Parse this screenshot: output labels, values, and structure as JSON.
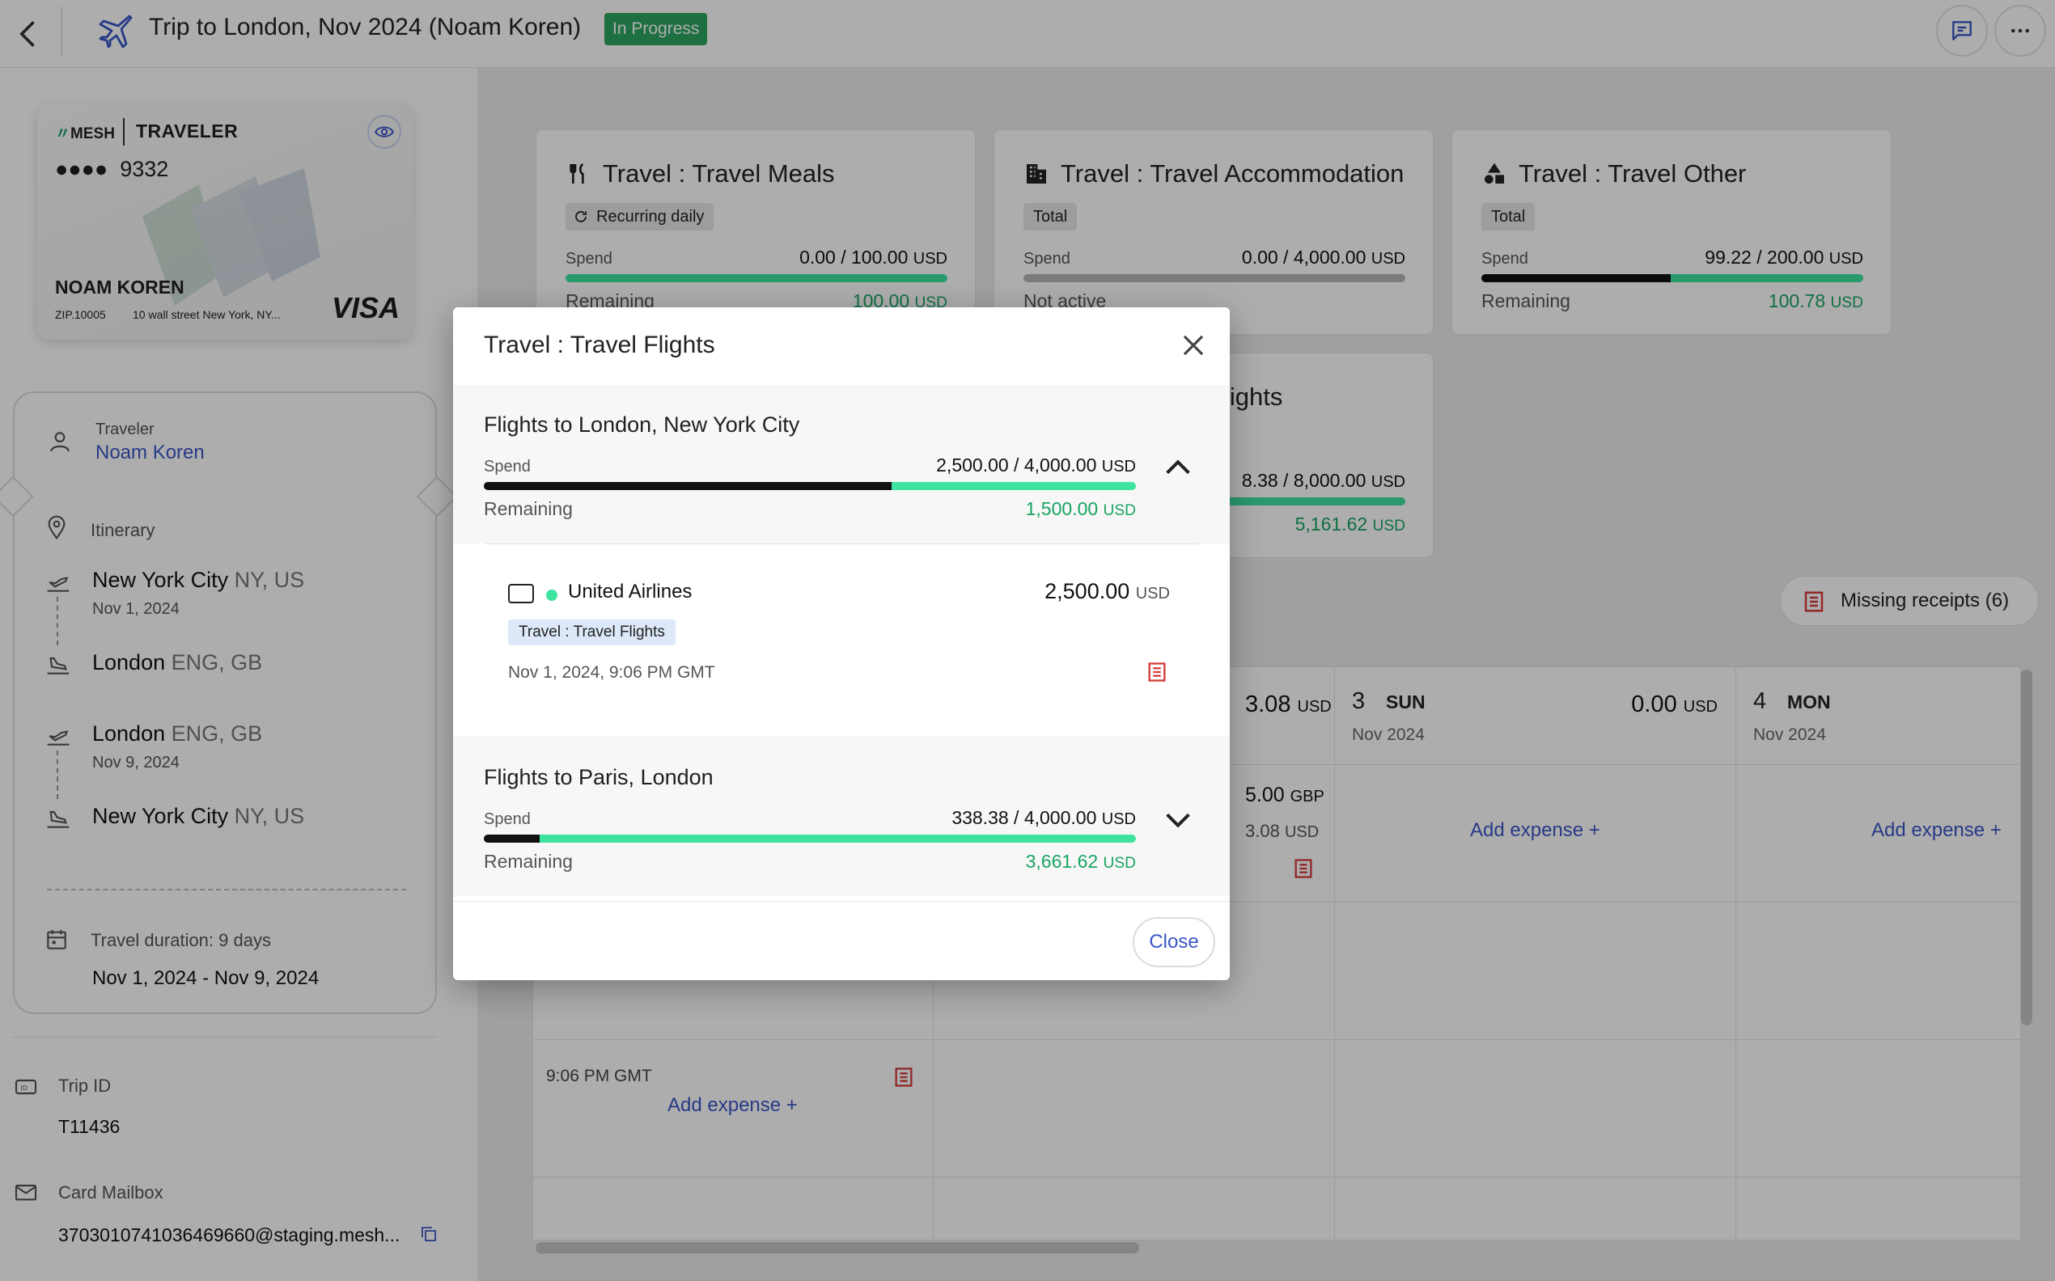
{
  "header": {
    "title": "Trip to London, Nov 2024 (Noam Koren)",
    "status": "In Progress"
  },
  "card": {
    "brand": "MESH",
    "kind": "TRAVELER",
    "dots": "●●●●",
    "last4": "9332",
    "holder": "NOAM KOREN",
    "zip": "ZIP.10005",
    "address": "10 wall street New York, NY...",
    "network": "VISA"
  },
  "ticket": {
    "traveler_label": "Traveler",
    "traveler_name": "Noam Koren",
    "itinerary_label": "Itinerary",
    "legs": [
      {
        "city": "New York City",
        "region": "NY, US",
        "date": "Nov 1, 2024"
      },
      {
        "city": "London",
        "region": "ENG, GB",
        "date": ""
      },
      {
        "city": "London",
        "region": "ENG, GB",
        "date": "Nov 9, 2024"
      },
      {
        "city": "New York City",
        "region": "NY, US",
        "date": ""
      }
    ],
    "duration_label": "Travel duration: 9 days",
    "duration_range": "Nov 1, 2024 - Nov 9, 2024"
  },
  "trip_info": {
    "trip_id_label": "Trip ID",
    "trip_id": "T11436",
    "mailbox_label": "Card Mailbox",
    "mailbox": "3703010741036469660@staging.mesh..."
  },
  "budgets": {
    "meals": {
      "title": "Travel : Travel Meals",
      "chip": "Recurring daily",
      "spend_label": "Spend",
      "spend": "0.00 / 100.00",
      "unit": "USD",
      "remaining_label": "Remaining",
      "remaining": "100.00",
      "spent_fraction": 0.0
    },
    "accommodation": {
      "title": "Travel : Travel Accommodation",
      "chip": "Total",
      "spend_label": "Spend",
      "spend": "0.00 / 4,000.00",
      "unit": "USD",
      "remaining_label": "Not active",
      "spent_fraction": 0.0
    },
    "other": {
      "title": "Travel : Travel Other",
      "chip": "Total",
      "spend_label": "Spend",
      "spend": "99.22 / 200.00",
      "unit": "USD",
      "remaining_label": "Remaining",
      "remaining": "100.78",
      "spent_fraction": 0.496
    },
    "flights": {
      "title_tail": "lights",
      "spend_tail": "8.38 / 8,000.00",
      "unit": "USD",
      "remaining": "5,161.62",
      "spent_fraction": 0.35
    }
  },
  "missing_receipts": "Missing receipts (6)",
  "calendar": {
    "days": [
      {
        "num": "3",
        "name": "SUN",
        "sub": "Nov 2024",
        "total": "0.00",
        "unit": "USD"
      },
      {
        "num": "4",
        "name": "MON",
        "sub": "Nov 2024"
      }
    ],
    "partial_total": "3.08",
    "partial_unit": "USD",
    "partial_gbp": "5.00",
    "partial_gbp_unit": "GBP",
    "partial_usd2": "3.08",
    "partial_usd2_unit": "USD",
    "time_text": "9:06 PM GMT",
    "add_expense": "Add expense +"
  },
  "modal": {
    "title": "Travel : Travel Flights",
    "sections": [
      {
        "title": "Flights to London, New York City",
        "spend_label": "Spend",
        "spend": "2,500.00 / 4,000.00",
        "unit": "USD",
        "remaining_label": "Remaining",
        "remaining": "1,500.00",
        "spent_fraction": 0.625,
        "expanded": true
      },
      {
        "title": "Flights to Paris, London",
        "spend_label": "Spend",
        "spend": "338.38 / 4,000.00",
        "unit": "USD",
        "remaining_label": "Remaining",
        "remaining": "3,661.62",
        "spent_fraction": 0.085,
        "expanded": false
      }
    ],
    "transaction": {
      "merchant": "United Airlines",
      "amount": "2,500.00",
      "unit": "USD",
      "category": "Travel : Travel Flights",
      "datetime": "Nov 1, 2024, 9:06 PM GMT"
    },
    "close_label": "Close"
  },
  "colors": {
    "accent": "#3a56c6",
    "green": "#19a463",
    "bar_green": "#3ee39f",
    "status": "#2da562",
    "receipt_red": "#d63b3b"
  }
}
